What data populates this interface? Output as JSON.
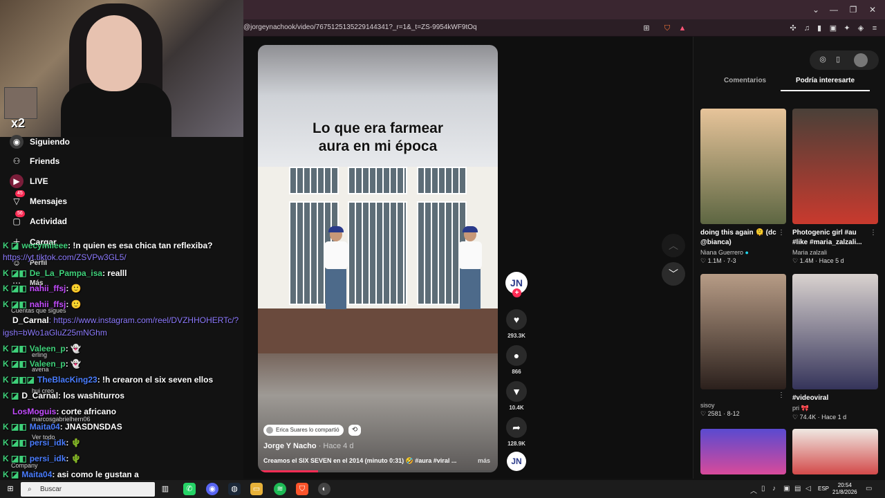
{
  "browser": {
    "url": "@jorgeynachook/video/7675125135229144341?_r=1&_t=ZS-9954kWF9tOq"
  },
  "webcam": {
    "overlay_text": "x2"
  },
  "sidebar": {
    "items": [
      {
        "label": "Siguiendo",
        "icon": "following-icon"
      },
      {
        "label": "Friends",
        "icon": "friends-icon"
      },
      {
        "label": "LIVE",
        "icon": "live-icon"
      },
      {
        "label": "Mensajes",
        "icon": "messages-icon",
        "badge": "45"
      },
      {
        "label": "Actividad",
        "icon": "activity-icon",
        "badge": "56"
      },
      {
        "label": "Cargar",
        "icon": "upload-icon"
      },
      {
        "label": "Perfil",
        "icon": "profile-icon"
      },
      {
        "label": "Más",
        "icon": "more-icon"
      }
    ],
    "following_heading": "Cuentas que sigues",
    "following": [
      "erling",
      "avena",
      "hui creo",
      "marcosgabrielhern06"
    ],
    "see_all": "Ver todo",
    "company": "Company"
  },
  "chat": [
    {
      "user": "wecymiieee",
      "color": "#3fd17a",
      "msg": ": !n quien es esa chica tan reflexiba?"
    },
    {
      "user": "",
      "color": "#8e7bff",
      "msg": "https://yt.tiktok.com/ZSVPw3GL5/"
    },
    {
      "user": "De_La_Pampa_isa",
      "color": "#3fd17a",
      "msg": ": realll"
    },
    {
      "user": "nahii_ffsj",
      "color": "#c44cff",
      "msg": ": 🙂"
    },
    {
      "user": "nahii_ffsj",
      "color": "#c44cff",
      "msg": ": 🙂"
    },
    {
      "user": "D_Carnal",
      "color": "#ffffff",
      "msg": ": https://www.instagram.com/reel/DVZHHOHERTc/?"
    },
    {
      "user": "",
      "color": "#8e7bff",
      "msg": "igsh=bWo1aGluZ25mNGhm"
    },
    {
      "user": "Valeen_p",
      "color": "#3fd17a",
      "msg": ": 👻"
    },
    {
      "user": "Valeen_p",
      "color": "#3fd17a",
      "msg": ": 👻"
    },
    {
      "user": "TheBlacKing23",
      "color": "#4a7dff",
      "msg": ": !h crearon el six seven ellos"
    },
    {
      "user": "D_Carnal",
      "color": "#ffffff",
      "msg": ": los washiturros"
    },
    {
      "user": "LosMoguis",
      "color": "#c44cff",
      "msg": ": corte africano"
    },
    {
      "user": "Maita04",
      "color": "#4a7dff",
      "msg": ": JNASDNSDAS"
    },
    {
      "user": "persi_idk",
      "color": "#4a7dff",
      "msg": ": 🌵"
    },
    {
      "user": "persi_idk",
      "color": "#4a7dff",
      "msg": ": 🌵"
    },
    {
      "user": "Maita04",
      "color": "#4a7dff",
      "msg": ": asi como le gustan a"
    }
  ],
  "video": {
    "caption_line1": "Lo que era farmear",
    "caption_line2": "aura en mi época",
    "shared_by": "Erica Suares lo compartió",
    "author": "Jorge Y Nacho",
    "posted": "· Hace 4 d",
    "description": "Creamos el SIX SEVEN en el 2014 (minuto 0:31) 🤣 #aura #viral ...",
    "more_label": "más",
    "progress": 0.25,
    "avatar_text": "JN"
  },
  "actions": {
    "likes": "293.3K",
    "comments": "866",
    "saves": "10.4K",
    "shares": "128.9K"
  },
  "panel": {
    "tab_comments": "Comentarios",
    "tab_interest": "Podría interesarte",
    "cards": [
      {
        "title": "doing this again 🫠 (dc @bianca)",
        "user": "Niana Guerrero",
        "verified": true,
        "likes": "1.1M",
        "date": "7-3",
        "color": "#7a7e58"
      },
      {
        "title": "Photogenic girl #au #like #maria_zalzali...",
        "user": "Maria zalzali",
        "likes": "1.4M",
        "date": "Hace 5 d",
        "color": "#b54a3a"
      },
      {
        "title": "",
        "user": "sisoy",
        "likes": "2581",
        "date": "8-12",
        "color": "#8a6a58"
      },
      {
        "title": "#videoviral",
        "user": "pri 🎀",
        "likes": "74.4K",
        "date": "Hace 1 d",
        "color": "#4a4a6a"
      },
      {
        "title": "",
        "user": "",
        "likes": "",
        "date": "",
        "color": "#4b3ea8"
      },
      {
        "title": "",
        "user": "",
        "likes": "",
        "date": "",
        "color": "#e8e2dc"
      }
    ]
  },
  "taskbar": {
    "search_placeholder": "Buscar",
    "lang": "ESP",
    "time": "20:54",
    "date": "21/8/2026"
  }
}
